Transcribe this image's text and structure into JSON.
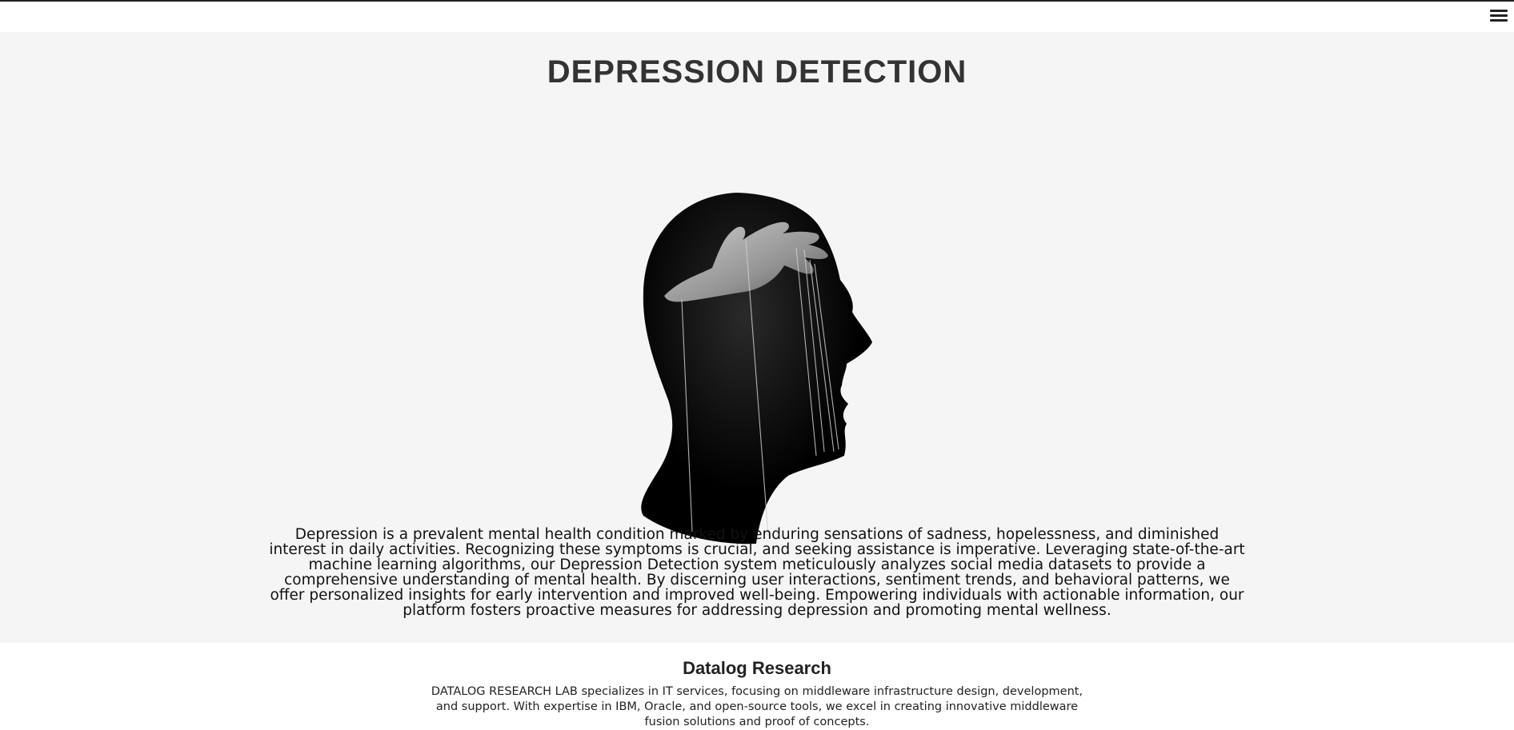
{
  "header": {
    "menu_icon": "hamburger-menu-icon"
  },
  "hero": {
    "title": "DEPRESSION DETECTION",
    "image_icon": "head-silhouette-puppet-hand-image",
    "description": "Depression is a prevalent mental health condition marked by enduring sensations of sadness, hopelessness, and diminished interest in daily activities. Recognizing these symptoms is crucial, and seeking assistance is imperative. Leveraging state-of-the-art machine learning algorithms, our Depression Detection system meticulously analyzes social media datasets to provide a comprehensive understanding of mental health. By discerning user interactions, sentiment trends, and behavioral patterns, we offer personalized insights for early intervention and improved well-being. Empowering individuals with actionable information, our platform fosters proactive measures for addressing depression and promoting mental wellness."
  },
  "footer": {
    "title": "Datalog Research",
    "text": "DATALOG RESEARCH LAB specializes in IT services, focusing on middleware infrastructure design, development, and support. With expertise in IBM, Oracle, and open-source tools, we excel in creating innovative middleware fusion solutions and proof of concepts."
  },
  "colors": {
    "page_background": "#f5f5f5",
    "header_background": "#ffffff",
    "footer_background": "#ffffff",
    "title_text": "#333333",
    "body_text": "#111111"
  }
}
